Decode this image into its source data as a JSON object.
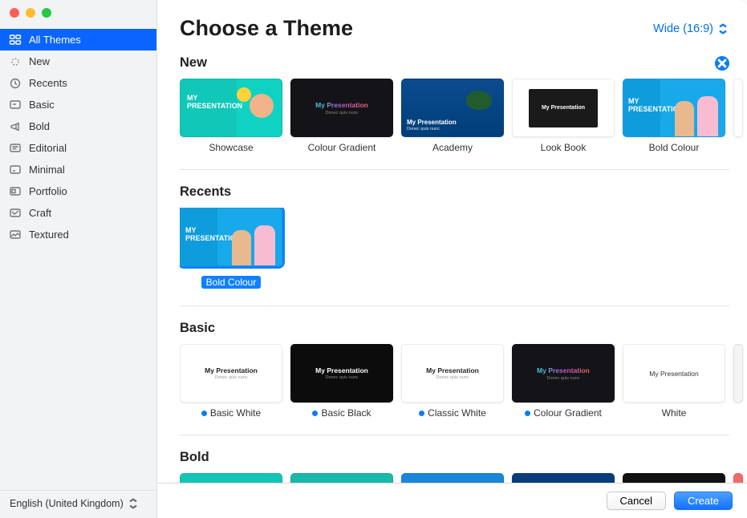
{
  "window": {
    "title": "Choose a Theme"
  },
  "sidebar": {
    "items": [
      {
        "label": "All Themes",
        "icon": "grid",
        "active": true
      },
      {
        "label": "New",
        "icon": "sparkle",
        "active": false
      },
      {
        "label": "Recents",
        "icon": "clock",
        "active": false
      },
      {
        "label": "Basic",
        "icon": "doc",
        "active": false
      },
      {
        "label": "Bold",
        "icon": "megaphone",
        "active": false
      },
      {
        "label": "Editorial",
        "icon": "lines",
        "active": false
      },
      {
        "label": "Minimal",
        "icon": "minimal",
        "active": false
      },
      {
        "label": "Portfolio",
        "icon": "portfolio",
        "active": false
      },
      {
        "label": "Craft",
        "icon": "craft",
        "active": false
      },
      {
        "label": "Textured",
        "icon": "textured",
        "active": false
      }
    ],
    "language": "English (United Kingdom)"
  },
  "header": {
    "aspect_label": "Wide (16:9)"
  },
  "sections": {
    "new": {
      "title": "New",
      "themes": [
        {
          "label": "Showcase"
        },
        {
          "label": "Colour Gradient"
        },
        {
          "label": "Academy"
        },
        {
          "label": "Look Book"
        },
        {
          "label": "Bold Colour"
        }
      ]
    },
    "recents": {
      "title": "Recents",
      "themes": [
        {
          "label": "Bold Colour",
          "selected": true
        }
      ]
    },
    "basic": {
      "title": "Basic",
      "themes": [
        {
          "label": "Basic White",
          "downloaded": true
        },
        {
          "label": "Basic Black",
          "downloaded": true
        },
        {
          "label": "Classic White",
          "downloaded": true
        },
        {
          "label": "Colour Gradient",
          "downloaded": true
        },
        {
          "label": "White",
          "downloaded": false
        }
      ]
    },
    "bold": {
      "title": "Bold"
    }
  },
  "thumb_text": {
    "my_presentation_upper": "MY\nPRESENTATION",
    "my_presentation": "My Presentation",
    "sub": "Donec quis nunc"
  },
  "footer": {
    "cancel": "Cancel",
    "create": "Create"
  }
}
